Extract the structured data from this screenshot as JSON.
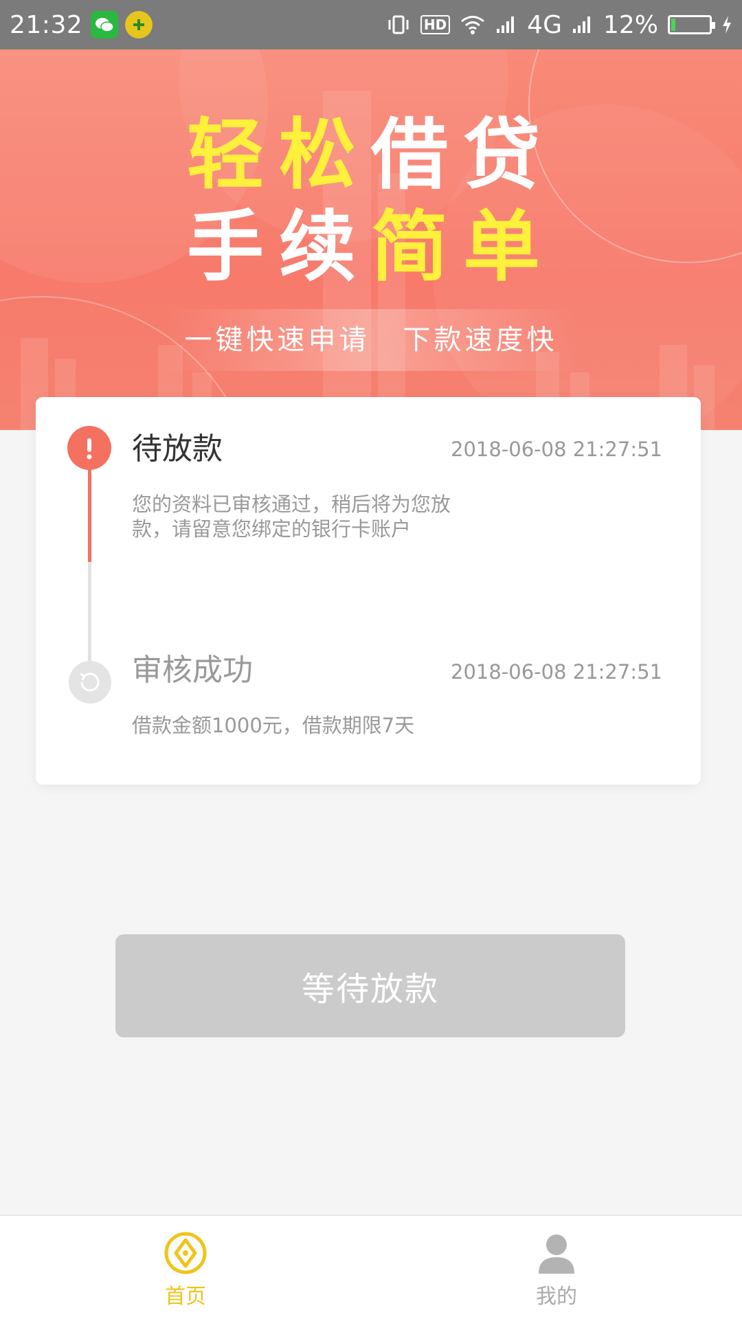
{
  "status_bar": {
    "time": "21:32",
    "network": "4G",
    "hd": "HD",
    "battery_percent": "12%",
    "battery_level": 0.12
  },
  "banner": {
    "headline_line1": {
      "part1": "轻松",
      "part2": "借贷"
    },
    "headline_line2": {
      "part1": "手续",
      "part2": "简单"
    },
    "slogan_left": "一键快速申请",
    "slogan_right": "下款速度快",
    "colors": {
      "yellow": "#fff03c",
      "background": "#f77a6b"
    }
  },
  "steps": [
    {
      "title": "待放款",
      "time": "2018-06-08 21:27:51",
      "description": "您的资料已审核通过，稍后将为您放款，请留意您绑定的银行卡账户",
      "icon": "exclamation-icon",
      "state": "active"
    },
    {
      "title": "审核成功",
      "time": "2018-06-08 21:27:51",
      "description": "借款金额1000元，借款期限7天",
      "icon": "refresh-icon",
      "state": "done"
    }
  ],
  "action": {
    "label": "等待放款",
    "enabled": false
  },
  "bottom_nav": [
    {
      "label": "首页",
      "icon": "coin-diamond-icon",
      "active": true
    },
    {
      "label": "我的",
      "icon": "user-avatar-icon",
      "active": false
    }
  ],
  "colors": {
    "accent": "#f47160",
    "nav_active": "#f0c419",
    "disabled": "#cbcbcb"
  }
}
